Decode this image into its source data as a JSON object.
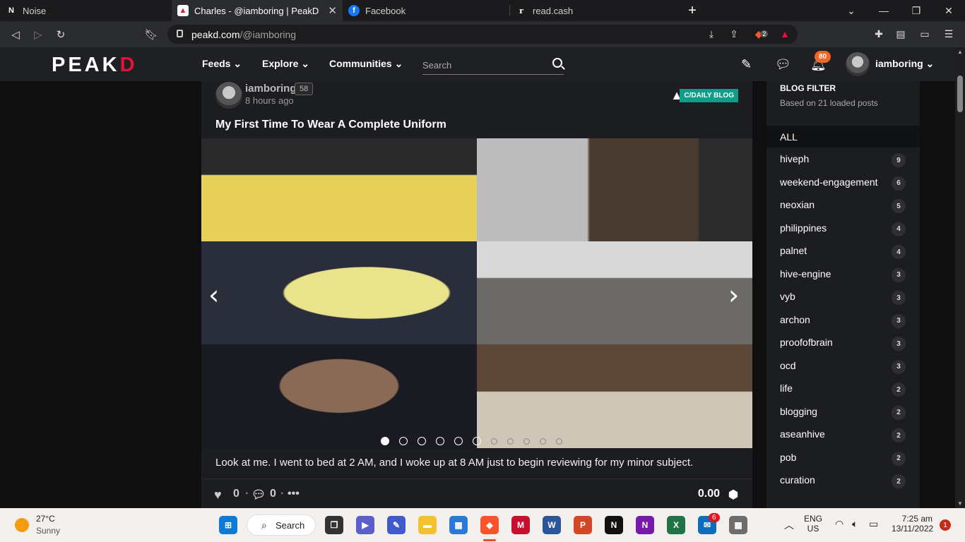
{
  "browser": {
    "tabs": [
      {
        "label": "Noise"
      },
      {
        "label": "Charles - @iamboring | PeakD"
      },
      {
        "label": "Facebook"
      },
      {
        "label": "read.cash"
      }
    ],
    "url_host": "peakd.com",
    "url_path": "/@iamboring",
    "brave_badge": "2"
  },
  "site": {
    "logo_main": "PEAK",
    "logo_accent": "D",
    "menu": [
      "Feeds",
      "Explore",
      "Communities"
    ],
    "search_placeholder": "Search",
    "notifications": "80",
    "user": "iamboring"
  },
  "post": {
    "author": "iamboring",
    "reputation": "58",
    "time": "8 hours ago",
    "community": "C/DAILY BLOG",
    "title": "My First Time To Wear A Complete Uniform",
    "excerpt": "Look at me. I went to bed at 2 AM, and I woke up at 8 AM just to begin reviewing for my minor subject.",
    "votes": "0",
    "comments": "0",
    "payout": "0.00",
    "gallery_pages": 11,
    "gallery_current": 1
  },
  "sidebar": {
    "title": "BLOG FILTER",
    "subtitle": "Based on 21 loaded posts",
    "all_label": "ALL",
    "tags": [
      {
        "name": "hiveph",
        "count": "9"
      },
      {
        "name": "weekend-engagement",
        "count": "6"
      },
      {
        "name": "neoxian",
        "count": "5"
      },
      {
        "name": "philippines",
        "count": "4"
      },
      {
        "name": "palnet",
        "count": "4"
      },
      {
        "name": "hive-engine",
        "count": "3"
      },
      {
        "name": "vyb",
        "count": "3"
      },
      {
        "name": "archon",
        "count": "3"
      },
      {
        "name": "proofofbrain",
        "count": "3"
      },
      {
        "name": "ocd",
        "count": "3"
      },
      {
        "name": "life",
        "count": "2"
      },
      {
        "name": "blogging",
        "count": "2"
      },
      {
        "name": "aseanhive",
        "count": "2"
      },
      {
        "name": "pob",
        "count": "2"
      },
      {
        "name": "curation",
        "count": "2"
      }
    ]
  },
  "taskbar": {
    "temperature": "27°C",
    "weather": "Sunny",
    "search_label": "Search",
    "mail_badge": "6",
    "language": "ENG",
    "region": "US",
    "time": "7:25 am",
    "date": "13/11/2022",
    "notification_count": "1"
  }
}
